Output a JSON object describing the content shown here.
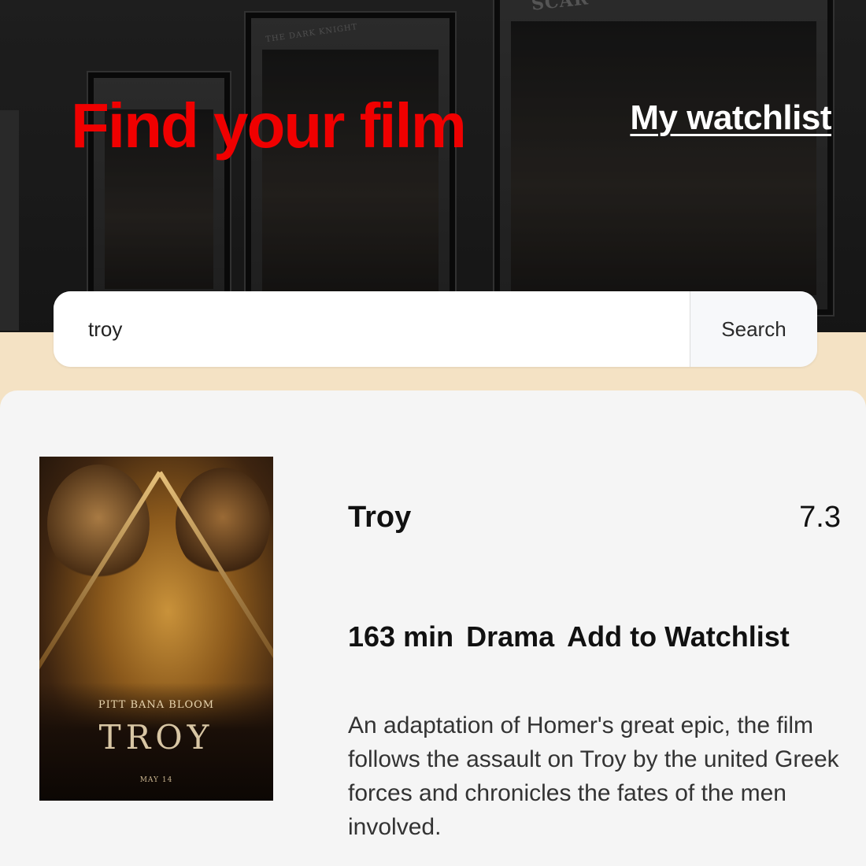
{
  "header": {
    "title": "Find your film",
    "watchlist_link": "My watchlist",
    "title_color": "#f00000"
  },
  "background_posters": [
    {
      "caption": ""
    },
    {
      "caption": "THE DARK KNIGHT"
    },
    {
      "caption": "SCAR"
    }
  ],
  "search": {
    "value": "troy",
    "button_label": "Search"
  },
  "result": {
    "poster": {
      "title": "TROY",
      "actors": "PITT  BANA  BLOOM",
      "release": "MAY 14"
    },
    "title": "Troy",
    "rating": "7.3",
    "runtime": "163 min",
    "genre": "Drama",
    "action_label": "Add to Watchlist",
    "plot": "An adaptation of Homer's great epic, the film follows the assault on Troy by the united Greek forces and chronicles the fates of the men involved."
  }
}
